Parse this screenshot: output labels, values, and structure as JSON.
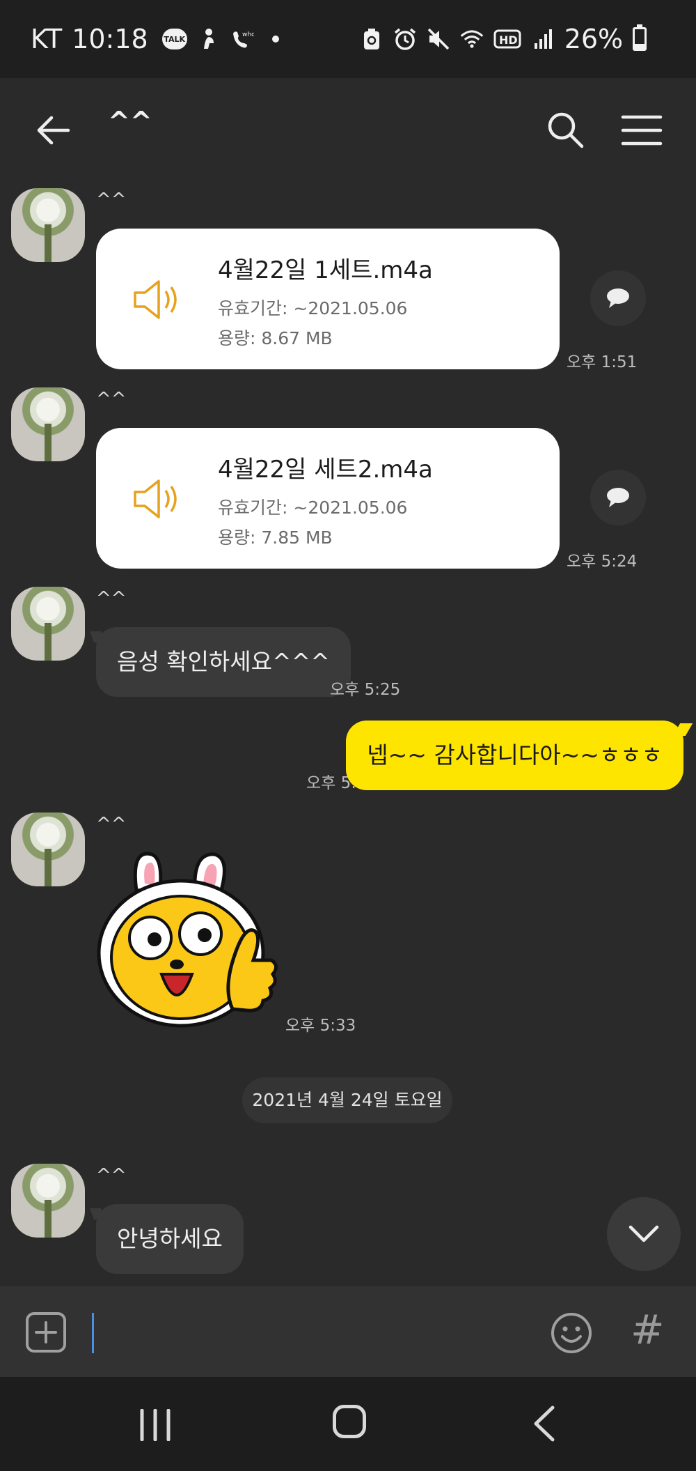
{
  "status_bar": {
    "carrier": "KT",
    "time": "10:18",
    "battery_percent": "26%",
    "battery_level": 0.26,
    "hd_label": "HD",
    "talk_label": "TALK",
    "icons": [
      "talk-icon",
      "fitness-icon",
      "whowho-icon",
      "dot-icon",
      "recycle-icon",
      "alarm-icon",
      "mute-icon",
      "wifi-icon",
      "hd-icon",
      "signal-icon",
      "battery-icon"
    ]
  },
  "header": {
    "title": "^^",
    "icons": [
      "back-arrow-icon",
      "search-icon",
      "menu-icon"
    ]
  },
  "messages": [
    {
      "type": "file",
      "sender": "^^",
      "file_name": "4월22일 1세트.m4a",
      "expiry": "유효기간: ~2021.05.06",
      "size": "용량: 8.67 MB",
      "time": "오후 1:51"
    },
    {
      "type": "file",
      "sender": "^^",
      "file_name": "4월22일 세트2.m4a",
      "expiry": "유효기간: ~2021.05.06",
      "size": "용량: 7.85 MB",
      "time": "오후 5:24"
    },
    {
      "type": "text_in",
      "sender": "^^",
      "text": "음성 확인하세요^^^",
      "time": "오후 5:25"
    },
    {
      "type": "text_out",
      "text": "넵~~ 감사합니다아~~ㅎㅎㅎ",
      "time": "오후 5:27"
    },
    {
      "type": "sticker",
      "sender": "^^",
      "sticker_icon": "rabbit-hood-thumbs-up-sticker",
      "time": "오후 5:33"
    },
    {
      "type": "date_divider",
      "text": "2021년 4월 24일 토요일"
    },
    {
      "type": "text_in",
      "sender": "^^",
      "text": "안녕하세요"
    }
  ],
  "input_bar": {
    "value": "",
    "icons": [
      "plus-icon",
      "emoji-icon",
      "hashtag-icon"
    ],
    "hash_label": "#"
  },
  "colors": {
    "background": "#2a2a2a",
    "my_bubble": "#fee500",
    "their_bubble": "#3a3a3a",
    "file_card": "#ffffff",
    "speaker_icon": "#e6a21c",
    "caret": "#4a90e2"
  }
}
